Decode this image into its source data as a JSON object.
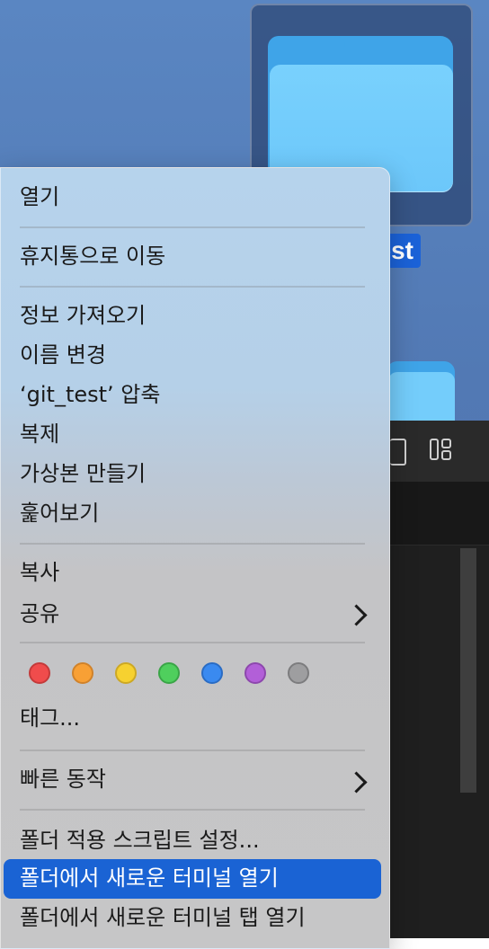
{
  "desktop": {
    "folder_label": "git_test"
  },
  "context_menu": {
    "items": {
      "open": "열기",
      "move_to_trash": "휴지통으로 이동",
      "get_info": "정보 가져오기",
      "rename": "이름 변경",
      "compress": "‘git_test’ 압축",
      "duplicate": "복제",
      "make_alias": "가상본 만들기",
      "quick_look": "훑어보기",
      "copy": "복사",
      "share": "공유",
      "tags": "태그...",
      "quick_actions": "빠른 동작",
      "folder_actions_setup": "폴더 적용 스크립트 설정...",
      "new_terminal_at_folder": "폴더에서 새로운 터미널 열기",
      "new_terminal_tab_at_folder": "폴더에서 새로운 터미널 탭 열기"
    },
    "highlighted_item": "new_terminal_at_folder",
    "tag_colors": [
      {
        "name": "red",
        "fill": "#f04c4c",
        "border": "#c43a3a"
      },
      {
        "name": "orange",
        "fill": "#f8a035",
        "border": "#d0822a"
      },
      {
        "name": "yellow",
        "fill": "#f6d130",
        "border": "#cca824"
      },
      {
        "name": "green",
        "fill": "#4fcf5d",
        "border": "#3aa547"
      },
      {
        "name": "blue",
        "fill": "#3a8af0",
        "border": "#2a6cc4"
      },
      {
        "name": "purple",
        "fill": "#b25fd8",
        "border": "#8d47ad"
      },
      {
        "name": "gray",
        "fill": "#9e9ea0",
        "border": "#7c7c7e"
      }
    ]
  },
  "editor": {
    "more_label": "···"
  }
}
